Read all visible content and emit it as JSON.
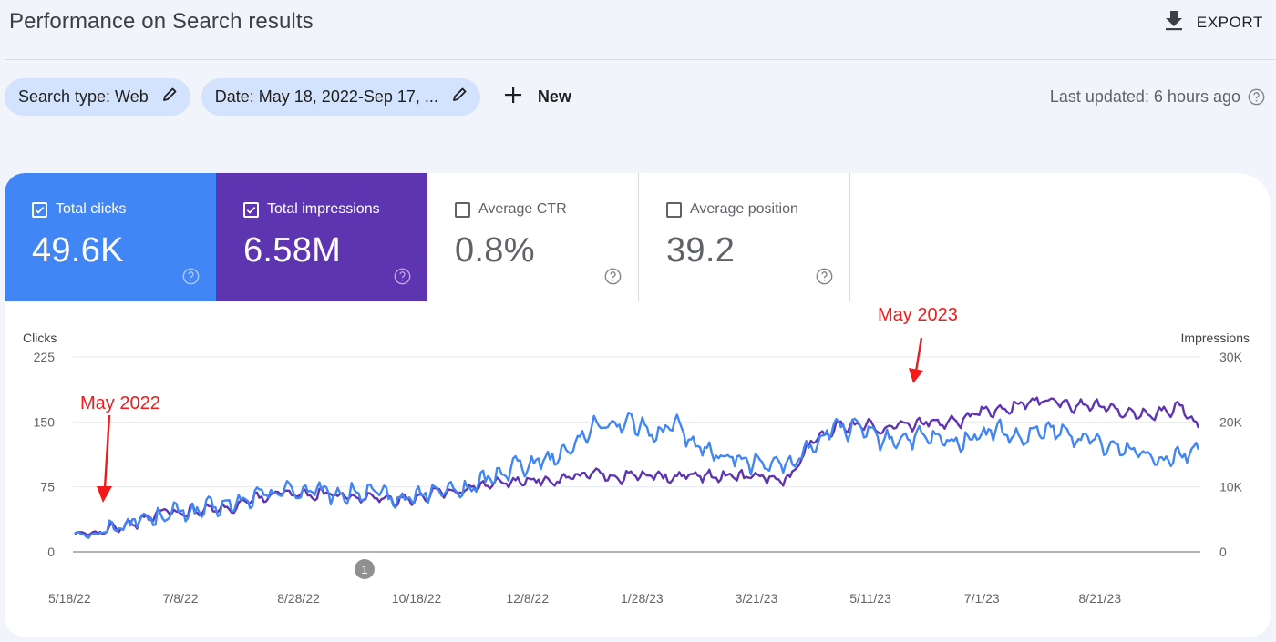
{
  "header": {
    "title": "Performance on Search results",
    "export_label": "EXPORT",
    "export_icon": "download-icon"
  },
  "filters": {
    "chips": [
      {
        "label": "Search type: Web",
        "icon": "pencil-icon"
      },
      {
        "label": "Date: May 18, 2022-Sep 17, ...",
        "icon": "pencil-icon"
      }
    ],
    "new_label": "New",
    "new_icon": "plus-icon",
    "last_updated": "Last updated: 6 hours ago",
    "last_updated_icon": "help-circle-icon"
  },
  "metrics": [
    {
      "label": "Total clicks",
      "value": "49.6K",
      "checked": true,
      "color": "#4285f4"
    },
    {
      "label": "Total impressions",
      "value": "6.58M",
      "checked": true,
      "color": "#5e35b1"
    },
    {
      "label": "Average CTR",
      "value": "0.8%",
      "checked": false
    },
    {
      "label": "Average position",
      "value": "39.2",
      "checked": false
    }
  ],
  "chart_data": {
    "type": "line",
    "title": "",
    "x_start": "2022-05-18",
    "x_end": "2023-09-17",
    "x_ticks": [
      "5/18/22",
      "7/8/22",
      "8/28/22",
      "10/18/22",
      "12/8/22",
      "1/28/23",
      "3/21/23",
      "5/11/23",
      "7/1/23",
      "8/21/23"
    ],
    "y_left": {
      "label": "Clicks",
      "ticks": [
        "0",
        "75",
        "150",
        "225"
      ],
      "range": [
        0,
        225
      ]
    },
    "y_right": {
      "label": "Impressions",
      "ticks": [
        "0",
        "10K",
        "20K",
        "30K"
      ],
      "range": [
        0,
        30000
      ]
    },
    "grid": true,
    "annotation_marker": {
      "label": "1",
      "date": "2022-09-29"
    },
    "annotations": [
      {
        "text": "May 2022",
        "date": "2022-05-28",
        "color": "#f21a1a"
      },
      {
        "text": "May 2023",
        "date": "2023-05-18",
        "color": "#f21a1a"
      }
    ],
    "series": [
      {
        "name": "Clicks",
        "axis": "left",
        "color": "#4285f4",
        "anchors_x": [
          0,
          10,
          20,
          30,
          40,
          50,
          60,
          70,
          80,
          90,
          100,
          110,
          120,
          130,
          140,
          150,
          160,
          170,
          180,
          190,
          200,
          210,
          220,
          230,
          240,
          250,
          260,
          270,
          280,
          290,
          300,
          310,
          320,
          330,
          340,
          350,
          360,
          370,
          380,
          390,
          400,
          410,
          420,
          430,
          440,
          450,
          460,
          470,
          480,
          485
        ],
        "anchors_y": [
          22,
          20,
          32,
          38,
          44,
          46,
          50,
          55,
          64,
          72,
          70,
          66,
          68,
          66,
          60,
          66,
          70,
          72,
          85,
          100,
          105,
          112,
          135,
          150,
          150,
          135,
          150,
          120,
          110,
          105,
          100,
          100,
          125,
          145,
          140,
          128,
          132,
          130,
          125,
          135,
          140,
          128,
          140,
          135,
          128,
          120,
          118,
          110,
          115,
          118
        ],
        "noise": 16
      },
      {
        "name": "Impressions",
        "axis": "right",
        "color": "#5e35b1",
        "anchors_x": [
          0,
          10,
          20,
          30,
          40,
          50,
          60,
          70,
          80,
          90,
          100,
          110,
          120,
          130,
          140,
          150,
          160,
          170,
          180,
          190,
          200,
          210,
          220,
          230,
          240,
          250,
          260,
          270,
          280,
          290,
          300,
          310,
          320,
          330,
          340,
          350,
          360,
          370,
          380,
          390,
          400,
          410,
          420,
          430,
          440,
          450,
          460,
          470,
          480,
          485
        ],
        "anchors_y": [
          2700,
          2800,
          4000,
          5000,
          6000,
          6300,
          6500,
          7000,
          8300,
          9000,
          9000,
          8800,
          8600,
          8300,
          8200,
          8500,
          9200,
          9600,
          10500,
          11000,
          11300,
          11100,
          11800,
          11800,
          11600,
          11500,
          11700,
          11600,
          11500,
          11400,
          11600,
          11500,
          17500,
          19200,
          19500,
          19000,
          19500,
          20000,
          20000,
          21000,
          22000,
          22500,
          23500,
          22500,
          23000,
          21800,
          21200,
          21500,
          22500,
          19500
        ],
        "noise": 1300
      }
    ]
  }
}
